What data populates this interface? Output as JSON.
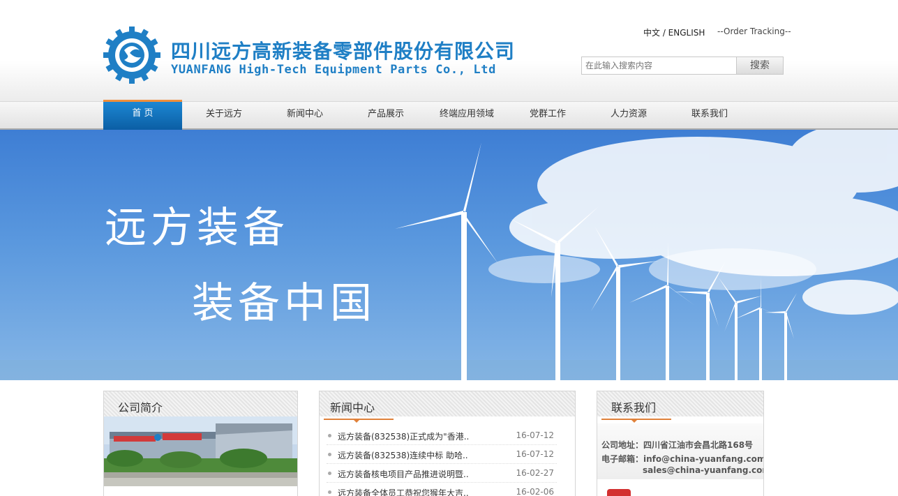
{
  "header": {
    "company_cn": "四川远方高新装备零部件股份有限公司",
    "company_en": "YUANFANG High-Tech Equipment Parts Co., Ltd",
    "lang_switch": "中文 / ENGLISH",
    "order_tracking": "--Order Tracking--",
    "search": {
      "placeholder": "在此输入搜索内容",
      "button": "搜索"
    },
    "logo_icon": "gear-logo-icon"
  },
  "nav": {
    "items": [
      {
        "label": "首 页",
        "active": true
      },
      {
        "label": "关于远方"
      },
      {
        "label": "新闻中心"
      },
      {
        "label": "产品展示"
      },
      {
        "label": "终端应用领域"
      },
      {
        "label": "党群工作"
      },
      {
        "label": "人力资源"
      },
      {
        "label": "联系我们"
      }
    ]
  },
  "banner": {
    "slogan_line1": "远方装备",
    "slogan_line2": "装备中国"
  },
  "intro": {
    "title": "公司简介"
  },
  "news": {
    "title": "新闻中心",
    "items": [
      {
        "title": "远方装备(832538)正式成为\"香港..",
        "date": "16-07-12"
      },
      {
        "title": "远方装备(832538)连续中标 助哈..",
        "date": "16-07-12"
      },
      {
        "title": "远方装备核电项目产品推进说明暨..",
        "date": "16-02-27"
      },
      {
        "title": "远方装备全体员工恭祝您猴年大吉..",
        "date": "16-02-06"
      }
    ]
  },
  "contact": {
    "title": "联系我们",
    "address": "公司地址：四川省江油市会昌北路168号",
    "email_label": "电子邮箱：info@china-yuanfang.com",
    "email2": "sales@china-yuanfang.com"
  },
  "colors": {
    "brand_blue": "#1f7fc5",
    "nav_active": "#0b5ea4",
    "accent_orange": "#e0813a"
  }
}
